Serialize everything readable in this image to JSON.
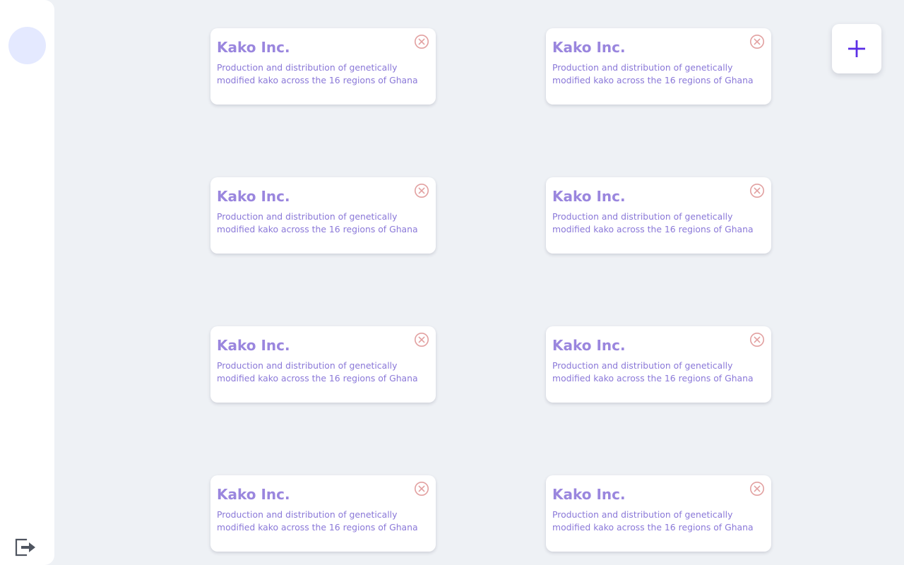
{
  "sidebar": {
    "avatar_icon": "user-avatar",
    "logout_icon": "logout-icon"
  },
  "add_button": {
    "icon": "plus-icon",
    "color": "#5b2ee6"
  },
  "colors": {
    "background": "#eef1f5",
    "card": "#ffffff",
    "card_title": "#9a86de",
    "card_desc": "#8a78d8",
    "close_icon": "#e2a0a0",
    "avatar": "#e4e9ff"
  },
  "cards": [
    {
      "title": "Kako Inc.",
      "description": "Production and distribution of genetically modified kako across the 16 regions of Ghana"
    },
    {
      "title": "Kako Inc.",
      "description": "Production and distribution of genetically modified kako across the 16 regions of Ghana"
    },
    {
      "title": "Kako Inc.",
      "description": "Production and distribution of genetically modified kako across the 16 regions of Ghana"
    },
    {
      "title": "Kako Inc.",
      "description": "Production and distribution of genetically modified kako across the 16 regions of Ghana"
    },
    {
      "title": "Kako Inc.",
      "description": "Production and distribution of genetically modified kako across the 16 regions of Ghana"
    },
    {
      "title": "Kako Inc.",
      "description": "Production and distribution of genetically modified kako across the 16 regions of Ghana"
    },
    {
      "title": "Kako Inc.",
      "description": "Production and distribution of genetically modified kako across the 16 regions of Ghana"
    },
    {
      "title": "Kako Inc.",
      "description": "Production and distribution of genetically modified kako across the 16 regions of Ghana"
    }
  ]
}
